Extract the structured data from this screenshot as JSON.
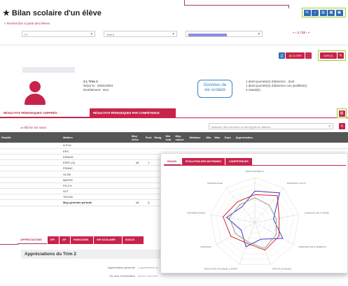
{
  "page": {
    "title": "Bilan scolaire d'un élève",
    "back_link": "< Rechercher à partir des élèves"
  },
  "filters": {
    "class_value": "3 I",
    "period_value": "Trim 2",
    "student_value": ""
  },
  "navigation": {
    "pager": "« ‹ 1 / 23 › »"
  },
  "toolbar": {
    "close_label": "CLORE",
    "avis_label": "AVIS (0)"
  },
  "student": {
    "name": "",
    "period": "3 I, Trim 2",
    "birth": "Né(e) le : 29/01/2004",
    "doublement": "Doublement : Non",
    "absences": [
      "1 demi-journée(s) d'absence , dont",
      "1 demi-journée(s) d'absence non justifiée(s)",
      "2 retard(s)"
    ]
  },
  "callout": {
    "line1": "Données de",
    "line2": "vie scolaire"
  },
  "main_tabs": [
    {
      "label": "RÉSULTATS PÉRIODIQUES CHIFFRÉS",
      "active": true
    },
    {
      "label": "RÉSULTATS PÉRIODIQUES PAR COMPÉTENCE",
      "active": false
    }
  ],
  "results": {
    "show_notes": "▸ Afficher les notes",
    "mask_placeholder": "Masquer des colonnes ou des lignes du tableau",
    "headers": [
      "Famille",
      "Matière",
      "Moy élève",
      "Evol",
      "Rang",
      "Nbr éval",
      "Moy classe",
      "Médiane",
      "Min",
      "Max",
      "Grpe",
      "Appréciation"
    ],
    "rows": [
      {
        "matiere": "A-PLA",
        "moy": "",
        "evol": ""
      },
      {
        "matiere": "EPS",
        "moy": "",
        "evol": ""
      },
      {
        "matiere": "EDMUS",
        "moy": "",
        "evol": ""
      },
      {
        "matiere": "ESP2 (O)",
        "moy": "18",
        "evol": "1"
      },
      {
        "matiere": "FRANC",
        "moy": "",
        "evol": ""
      },
      {
        "matiere": "HI-GE",
        "moy": "",
        "evol": ""
      },
      {
        "matiere": "MATHS",
        "moy": "",
        "evol": ""
      },
      {
        "matiere": "PH-CH",
        "moy": "",
        "evol": ""
      },
      {
        "matiere": "SVT",
        "moy": "",
        "evol": ""
      },
      {
        "matiere": "TECHN",
        "moy": "",
        "evol": ""
      }
    ],
    "footer_label": "Moy générale période",
    "footer_moy": "18",
    "footer_evol": "1"
  },
  "popup": {
    "tabs": [
      {
        "label": "RADAR",
        "active": true
      },
      {
        "label": "ÉVOLUTION DES MOYENNES",
        "active": false
      },
      {
        "label": "COMPÉTENCES",
        "active": false
      }
    ]
  },
  "chart_data": {
    "type": "radar",
    "axes": [
      "PARALLÉLISME (7)",
      "ESPAGNOL LV2 (2)",
      "SCIENCES VIE & TERRE",
      "SCIENCES VIE & TERRE (2)",
      "ARTS PLASTIQUES",
      "ÉDUCATION PHYSIQUE & SPORT",
      "FRANÇAIS",
      "MATHÉMATIQUES",
      "TECHNOLOGIE"
    ],
    "series": [
      {
        "color": "#d62828",
        "values": [
          0.62,
          0.78,
          0.55,
          0.62,
          0.66,
          0.5,
          0.62,
          0.72,
          0.6
        ]
      },
      {
        "color": "#3d3dbf",
        "values": [
          0.7,
          0.86,
          0.42,
          0.72,
          0.4,
          0.58,
          0.35,
          0.64,
          0.45
        ]
      },
      {
        "color": "#999999",
        "values": [
          0.55,
          0.5,
          0.48,
          0.55,
          0.62,
          0.46,
          0.5,
          0.58,
          0.52
        ]
      }
    ],
    "rings": 8
  },
  "bottom_tabs": [
    {
      "label": "APPRECIATIONS",
      "active": true
    },
    {
      "label": "EPI",
      "active": false
    },
    {
      "label": "AP",
      "active": false
    },
    {
      "label": "PARCOURS",
      "active": false
    },
    {
      "label": "VIE SCOLAIRE",
      "active": false
    },
    {
      "label": "SOCLE",
      "active": false
    }
  ],
  "appreciations": {
    "title": "Appréciations du Trim 2",
    "rows": [
      {
        "label": "Appréciation générale",
        "value": "L'appréciation g"
      },
      {
        "label": "1er avis d'orientation",
        "value": "Aucun avis d'ori"
      }
    ]
  },
  "colors": {
    "accent": "#c8234b",
    "highlight": "#9bd12b",
    "icon_blue": "#2f6db3"
  }
}
